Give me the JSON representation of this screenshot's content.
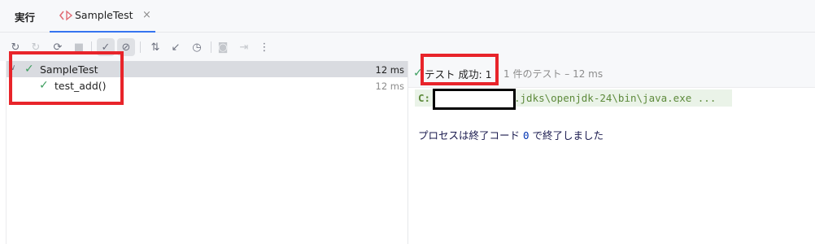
{
  "tabbar": {
    "title": "実行",
    "tab": {
      "label": "SampleTest",
      "icon": "run-config-icon",
      "close": "×"
    }
  },
  "toolbar": {
    "buttons": [
      {
        "name": "rerun-icon",
        "glyph": "↻",
        "state": "normal"
      },
      {
        "name": "rerun-failed-icon",
        "glyph": "↻",
        "state": "dim"
      },
      {
        "name": "toggle-auto-test-icon",
        "glyph": "⟳",
        "state": "normal"
      },
      {
        "name": "stop-icon",
        "glyph": "■",
        "state": "dim"
      },
      {
        "name": "show-passed-icon",
        "glyph": "✓",
        "state": "active"
      },
      {
        "name": "show-ignored-icon",
        "glyph": "⊘",
        "state": "active"
      },
      {
        "name": "sort-icon",
        "glyph": "⇅",
        "state": "normal"
      },
      {
        "name": "collapse-icon",
        "glyph": "↙",
        "state": "normal"
      },
      {
        "name": "history-icon",
        "glyph": "◷",
        "state": "normal"
      },
      {
        "name": "screenshot-icon",
        "glyph": "◙",
        "state": "dim"
      },
      {
        "name": "export-icon",
        "glyph": "⇥",
        "state": "dim"
      },
      {
        "name": "more-icon",
        "glyph": "⋮",
        "state": "normal"
      }
    ]
  },
  "tree": {
    "root": {
      "label": "SampleTest",
      "time": "12 ms",
      "status": "passed"
    },
    "children": [
      {
        "label": "test_add()",
        "time": "12 ms",
        "status": "passed"
      }
    ]
  },
  "console": {
    "status_text": "テスト 成功: 1",
    "summary": "1 件のテスト – 12 ms",
    "cmd_drive": "C:",
    "cmd_path": ".jdks\\openjdk-24\\bin\\java.exe ...",
    "exit_prefix": "プロセスは終了コード",
    "exit_code": "0",
    "exit_suffix": "で終了しました"
  },
  "colors": {
    "accent": "#3574f0",
    "success": "#3d9e5f",
    "highlight": "#e8242a",
    "console_bg": "#eaf3e8"
  }
}
